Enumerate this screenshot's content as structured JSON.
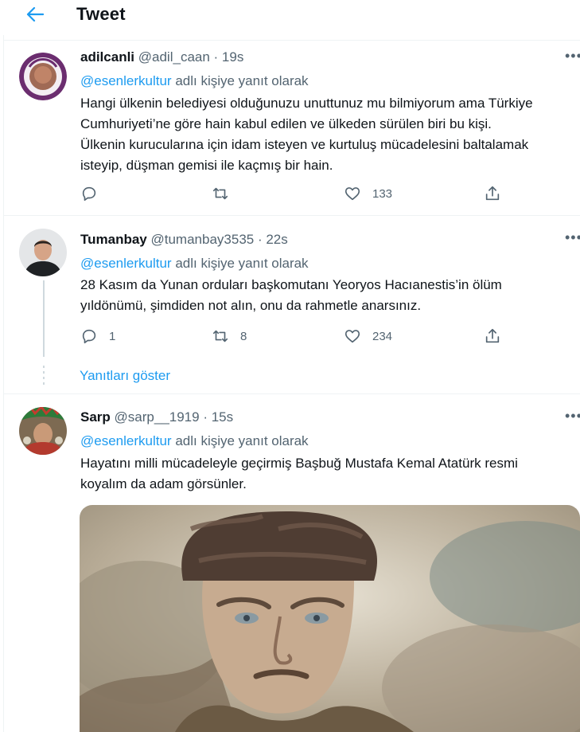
{
  "header": {
    "title": "Tweet"
  },
  "tweets": [
    {
      "name": "adilcanli",
      "handle": "@adil_caan",
      "time": "· 19s",
      "reply_prefix": "@esenlerkultur",
      "reply_suffix": " adlı kişiye yanıt olarak",
      "text": "Hangi ülkenin belediyesi olduğunuzu unuttunuz mu bilmiyorum ama Türkiye\nCumhuriyeti’ne göre hain kabul edilen ve ülkeden sürülen biri bu kişi.\nÜlkenin kurucularına için idam isteyen ve kurtuluş mücadelesini baltalamak\nisteyip, düşman gemisi ile kaçmış bir hain.",
      "reply_count": "",
      "retweet_count": "",
      "like_count": "133"
    },
    {
      "name": "Tumanbay",
      "handle": "@tumanbay3535",
      "time": "· 22s",
      "reply_prefix": "@esenlerkultur",
      "reply_suffix": " adlı kişiye yanıt olarak",
      "text": "28 Kasım da Yunan orduları başkomutanı Yeoryos Hacıanestis’in ölüm\nyıldönümü, şimdiden not alın, onu da rahmetle anarsınız.",
      "reply_count": "1",
      "retweet_count": "8",
      "like_count": "234"
    },
    {
      "name": "Sarp",
      "handle": "@sarp__1919",
      "time": "· 15s",
      "reply_prefix": "@esenlerkultur",
      "reply_suffix": " adlı kişiye yanıt olarak",
      "text": "Hayatını milli mücadeleyle geçirmiş Başbuğ Mustafa Kemal Atatürk resmi\nkoyalım da adam görsünler."
    }
  ],
  "show_replies": "Yanıtları göster",
  "more_label": "•••",
  "colors": {
    "accent": "#1d9bf0",
    "secondary_text": "#536471",
    "divider": "#eff3f4"
  }
}
